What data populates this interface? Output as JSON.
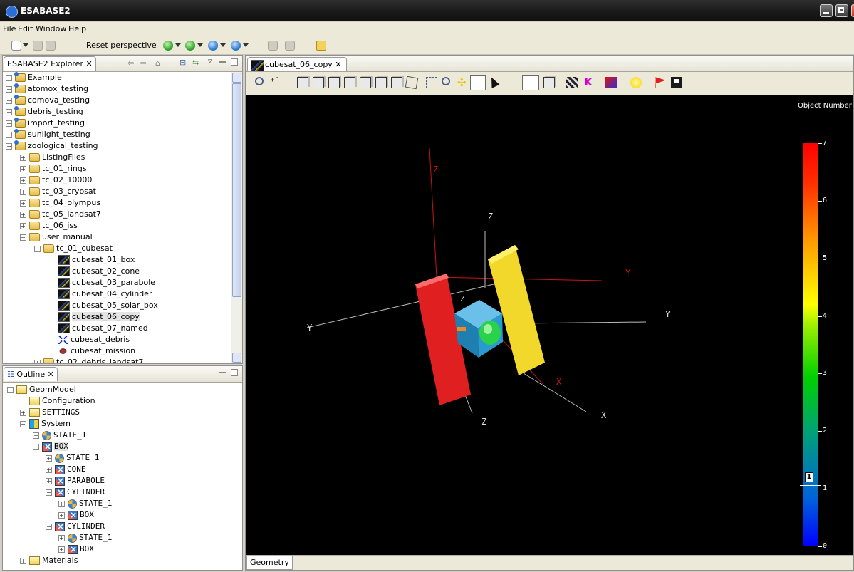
{
  "window": {
    "title": "ESABASE2"
  },
  "menu": [
    "File",
    "Edit",
    "Window",
    "Help"
  ],
  "toolbar": {
    "reset_perspective": "Reset perspective"
  },
  "explorer": {
    "tab_label": "ESABASE2 Explorer",
    "items": [
      {
        "label": "Example",
        "indent": 0,
        "type": "proj",
        "exp": "+"
      },
      {
        "label": "atomox_testing",
        "indent": 0,
        "type": "proj",
        "exp": "+"
      },
      {
        "label": "comova_testing",
        "indent": 0,
        "type": "proj",
        "exp": "+"
      },
      {
        "label": "debris_testing",
        "indent": 0,
        "type": "proj",
        "exp": "+"
      },
      {
        "label": "import_testing",
        "indent": 0,
        "type": "proj",
        "exp": "+"
      },
      {
        "label": "sunlight_testing",
        "indent": 0,
        "type": "proj",
        "exp": "+"
      },
      {
        "label": "zoological_testing",
        "indent": 0,
        "type": "proj",
        "exp": "−"
      },
      {
        "label": "ListingFiles",
        "indent": 1,
        "type": "folder",
        "exp": "+"
      },
      {
        "label": "tc_01_rings",
        "indent": 1,
        "type": "folder",
        "exp": "+"
      },
      {
        "label": "tc_02_10000",
        "indent": 1,
        "type": "folder",
        "exp": "+"
      },
      {
        "label": "tc_03_cryosat",
        "indent": 1,
        "type": "folder",
        "exp": "+"
      },
      {
        "label": "tc_04_olympus",
        "indent": 1,
        "type": "folder",
        "exp": "+"
      },
      {
        "label": "tc_05_landsat7",
        "indent": 1,
        "type": "folder",
        "exp": "+"
      },
      {
        "label": "tc_06_iss",
        "indent": 1,
        "type": "folder",
        "exp": "+"
      },
      {
        "label": "user_manual",
        "indent": 1,
        "type": "folder",
        "exp": "−"
      },
      {
        "label": "tc_01_cubesat",
        "indent": 2,
        "type": "folder",
        "exp": "−"
      },
      {
        "label": "cubesat_01_box",
        "indent": 3,
        "type": "fileimg",
        "exp": ""
      },
      {
        "label": "cubesat_02_cone",
        "indent": 3,
        "type": "fileimg",
        "exp": ""
      },
      {
        "label": "cubesat_03_parabole",
        "indent": 3,
        "type": "fileimg",
        "exp": ""
      },
      {
        "label": "cubesat_04_cylinder",
        "indent": 3,
        "type": "fileimg",
        "exp": ""
      },
      {
        "label": "cubesat_05_solar_box",
        "indent": 3,
        "type": "fileimg",
        "exp": ""
      },
      {
        "label": "cubesat_06_copy",
        "indent": 3,
        "type": "fileimg",
        "exp": "",
        "selected": true
      },
      {
        "label": "cubesat_07_named",
        "indent": 3,
        "type": "fileimg",
        "exp": ""
      },
      {
        "label": "cubesat_debris",
        "indent": 3,
        "type": "debris",
        "exp": ""
      },
      {
        "label": "cubesat_mission",
        "indent": 3,
        "type": "mission",
        "exp": ""
      },
      {
        "label": "tc_02_debris_landsat7",
        "indent": 2,
        "type": "folder",
        "exp": "+"
      }
    ]
  },
  "outline": {
    "tab_label": "Outline",
    "items": [
      {
        "label": "GeomModel",
        "indent": 0,
        "type": "ofold",
        "exp": "−",
        "mono": false
      },
      {
        "label": "Configuration",
        "indent": 1,
        "type": "ofold",
        "exp": "",
        "mono": false
      },
      {
        "label": "SETTINGS",
        "indent": 1,
        "type": "ofold",
        "exp": "+",
        "mono": true
      },
      {
        "label": "System",
        "indent": 1,
        "type": "system",
        "exp": "−",
        "mono": false
      },
      {
        "label": "STATE_1",
        "indent": 2,
        "type": "state",
        "exp": "+",
        "mono": true
      },
      {
        "label": "BOX",
        "indent": 2,
        "type": "boxi",
        "exp": "−",
        "mono": true,
        "selected": true
      },
      {
        "label": "STATE_1",
        "indent": 3,
        "type": "state",
        "exp": "+",
        "mono": true
      },
      {
        "label": "CONE",
        "indent": 3,
        "type": "boxi",
        "exp": "+",
        "mono": true
      },
      {
        "label": "PARABOLE",
        "indent": 3,
        "type": "boxi",
        "exp": "+",
        "mono": true
      },
      {
        "label": "CYLINDER",
        "indent": 3,
        "type": "boxi",
        "exp": "−",
        "mono": true
      },
      {
        "label": "STATE_1",
        "indent": 4,
        "type": "state",
        "exp": "+",
        "mono": true
      },
      {
        "label": "BOX",
        "indent": 4,
        "type": "boxi",
        "exp": "+",
        "mono": true
      },
      {
        "label": "CYLINDER",
        "indent": 3,
        "type": "boxi",
        "exp": "−",
        "mono": true
      },
      {
        "label": "STATE_1",
        "indent": 4,
        "type": "state",
        "exp": "+",
        "mono": true
      },
      {
        "label": "BOX",
        "indent": 4,
        "type": "boxi",
        "exp": "+",
        "mono": true
      },
      {
        "label": "Materials",
        "indent": 1,
        "type": "ofold",
        "exp": "+",
        "mono": false
      }
    ]
  },
  "editor": {
    "tab_label": "cubesat_06_copy",
    "bottom_tab": "Geometry",
    "colorbar": {
      "title": "Object Number",
      "labels": [
        "7",
        "6",
        "5",
        "4",
        "3",
        "2",
        "1",
        "0"
      ],
      "marker": "1"
    },
    "axes": {
      "z": "Z",
      "y": "Y",
      "x": "X"
    }
  }
}
